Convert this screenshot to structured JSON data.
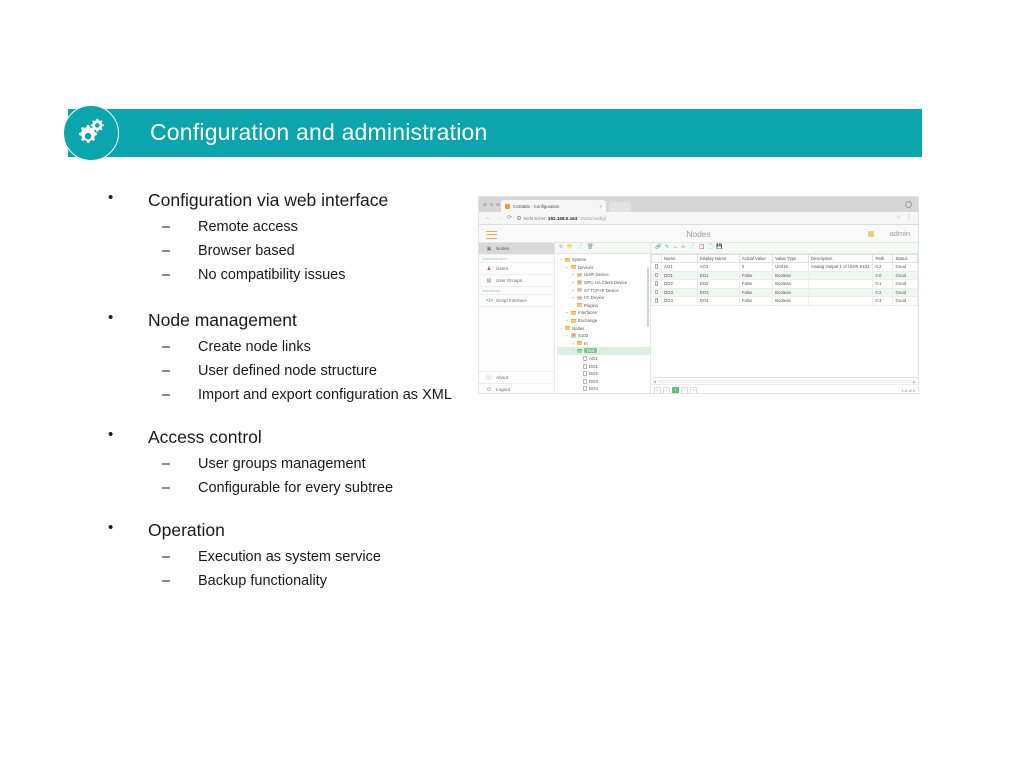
{
  "slide": {
    "banner_title": "Configuration and administration",
    "banner_icon": "gears-icon",
    "accent_color": "#0BA6AD",
    "groups": [
      {
        "heading": "Configuration via web interface",
        "items": [
          "Remote access",
          "Browser based",
          "No compatibility issues"
        ]
      },
      {
        "heading": "Node management",
        "items": [
          "Create node links",
          "User defined node structure",
          "Import and export configuration as XML"
        ]
      },
      {
        "heading": "Access control",
        "items": [
          "User groups management",
          "Configurable for every subtree"
        ]
      },
      {
        "heading": "Operation",
        "items": [
          "Execution as system service",
          "Backup functionality"
        ]
      }
    ]
  },
  "screenshot": {
    "browser": {
      "tab_title": "CoDaBix - Configuration",
      "tab_close": "×",
      "back_icon": "←",
      "forward_icon": "→",
      "reload_icon": "⟳",
      "security_label": "Nicht sicher",
      "url_host": "192.168.0.164",
      "url_path": ":8181/config/",
      "bookmark_icon": "☆",
      "menu_icon": "⋮",
      "profile_icon": "profile-icon"
    },
    "app": {
      "title": "Nodes",
      "user": "admin",
      "menu_icon": "hamburger-icon",
      "sidebar": {
        "primary": {
          "label": "Nodes",
          "icon": "nodes-icon"
        },
        "sections": [
          {
            "title": "Administration",
            "items": [
              {
                "label": "Users",
                "icon": "user-icon"
              },
              {
                "label": "User Groups",
                "icon": "users-group-icon"
              }
            ]
          },
          {
            "title": "Interfaces",
            "items": [
              {
                "label": "Script Interface",
                "icon": "code-icon"
              }
            ]
          }
        ],
        "bottom": [
          {
            "label": "About",
            "icon": "info-icon"
          },
          {
            "label": "Logout",
            "icon": "power-icon"
          }
        ]
      },
      "toolbar_left": [
        "refresh-icon",
        "new-folder-icon",
        "new-file-icon",
        "delete-icon"
      ],
      "toolbar_right": [
        "link-icon",
        "edit-icon",
        "rename-icon",
        "chain-icon",
        "copy-icon",
        "paste-icon",
        "duplicate-icon",
        "export-icon"
      ],
      "tree": [
        {
          "label": "System",
          "indent": 1,
          "expander": "−",
          "icon": "folder"
        },
        {
          "label": "Devices",
          "indent": 2,
          "expander": "−",
          "icon": "folder"
        },
        {
          "label": "UniPi Device",
          "indent": 3,
          "expander": "+",
          "icon": "device"
        },
        {
          "label": "OPC-UA Client Device",
          "indent": 3,
          "expander": "+",
          "icon": "device"
        },
        {
          "label": "S7 TCP-IP Device",
          "indent": 3,
          "expander": "+",
          "icon": "device"
        },
        {
          "label": "I²C Device",
          "indent": 3,
          "expander": "+",
          "icon": "device"
        },
        {
          "label": "Plugins",
          "indent": 2,
          "expander": "",
          "icon": "folder"
        },
        {
          "label": "Interfaces",
          "indent": 2,
          "expander": "+",
          "icon": "folder"
        },
        {
          "label": "Exchange",
          "indent": 2,
          "expander": "+",
          "icon": "folder"
        },
        {
          "label": "Nodes",
          "indent": 1,
          "expander": "−",
          "icon": "folder"
        },
        {
          "label": "S103",
          "indent": 2,
          "expander": "−",
          "icon": "device"
        },
        {
          "label": "In",
          "indent": 3,
          "expander": "+",
          "icon": "folder"
        },
        {
          "label": "Out",
          "indent": 3,
          "expander": "−",
          "icon": "folder-green",
          "selected": true
        },
        {
          "label": "AO1",
          "indent": 4,
          "expander": "",
          "icon": "file"
        },
        {
          "label": "DO1",
          "indent": 4,
          "expander": "",
          "icon": "file"
        },
        {
          "label": "DO2",
          "indent": 4,
          "expander": "",
          "icon": "file"
        },
        {
          "label": "DO3",
          "indent": 4,
          "expander": "",
          "icon": "file"
        },
        {
          "label": "DO4",
          "indent": 4,
          "expander": "",
          "icon": "file"
        }
      ],
      "table": {
        "columns": [
          "Name",
          "Display Name",
          "Actual Value",
          "Value Type",
          "Description",
          "Path",
          "Status"
        ],
        "rows": [
          [
            "AO1",
            "AO1",
            "0",
            "UInt16",
            "Analog Output 1 of UniPi S103",
            "0.2",
            "Good"
          ],
          [
            "DO1",
            "DO1",
            "False",
            "Boolean",
            "",
            "0.0",
            "Good"
          ],
          [
            "DO2",
            "DO2",
            "False",
            "Boolean",
            "",
            "0.1",
            "Good"
          ],
          [
            "DO3",
            "DO3",
            "False",
            "Boolean",
            "",
            "0.2",
            "Good"
          ],
          [
            "DO4",
            "DO4",
            "False",
            "Boolean",
            "",
            "0.3",
            "Good"
          ]
        ]
      },
      "pager": {
        "first": "«",
        "prev": "‹",
        "current": "1",
        "next": "›",
        "last": "»",
        "count": "1-5 of 5"
      }
    }
  }
}
